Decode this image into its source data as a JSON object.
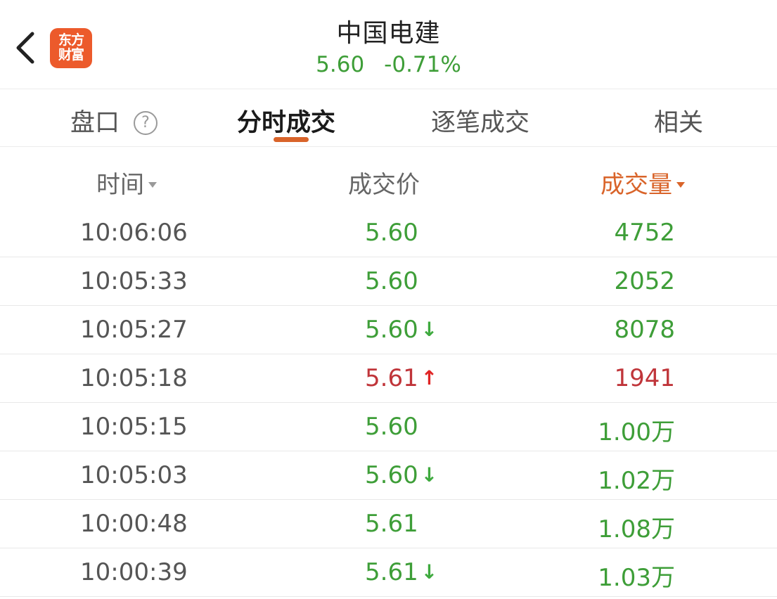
{
  "header": {
    "back_icon": "chevron-left-icon",
    "logo_line1": "东方",
    "logo_line2": "财富",
    "logo_color": "#ec5a2b",
    "stock_name": "中国电建",
    "price": "5.60",
    "change_pct": "-0.71%"
  },
  "tabs": [
    {
      "label": "盘口",
      "help": "?"
    },
    {
      "label": "分时成交",
      "active": true
    },
    {
      "label": "逐笔成交"
    },
    {
      "label": "相关"
    }
  ],
  "columns": {
    "time": "时间",
    "price": "成交价",
    "volume": "成交量"
  },
  "colors": {
    "up": "#c0353a",
    "down": "#3e9e38",
    "accent": "#d9642a"
  },
  "trades": [
    {
      "time": "10:06:06",
      "price": "5.60",
      "arrow": "",
      "volume": "4752",
      "color": "green"
    },
    {
      "time": "10:05:33",
      "price": "5.60",
      "arrow": "",
      "volume": "2052",
      "color": "green"
    },
    {
      "time": "10:05:27",
      "price": "5.60",
      "arrow": "down",
      "volume": "8078",
      "color": "green"
    },
    {
      "time": "10:05:18",
      "price": "5.61",
      "arrow": "up",
      "volume": "1941",
      "color": "red"
    },
    {
      "time": "10:05:15",
      "price": "5.60",
      "arrow": "",
      "volume": "1.00万",
      "color": "green"
    },
    {
      "time": "10:05:03",
      "price": "5.60",
      "arrow": "down",
      "volume": "1.02万",
      "color": "green"
    },
    {
      "time": "10:00:48",
      "price": "5.61",
      "arrow": "",
      "volume": "1.08万",
      "color": "green"
    },
    {
      "time": "10:00:39",
      "price": "5.61",
      "arrow": "down",
      "volume": "1.03万",
      "color": "green"
    }
  ]
}
